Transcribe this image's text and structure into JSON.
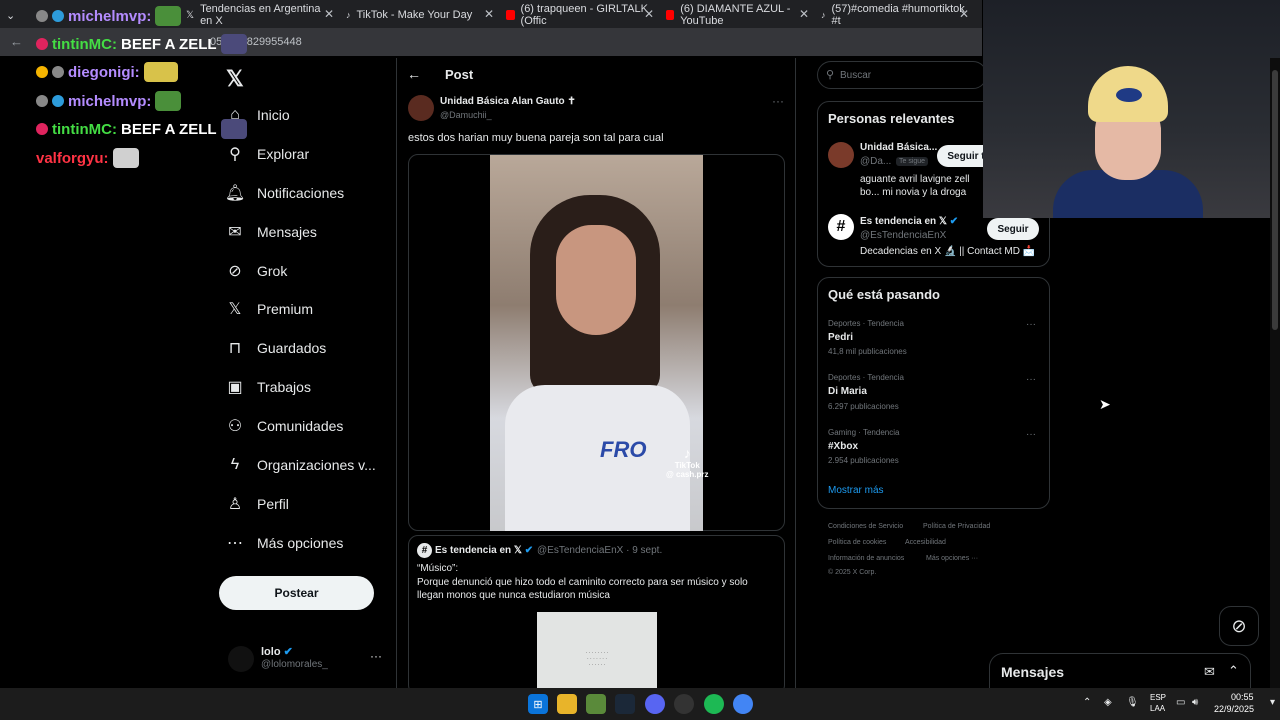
{
  "browser": {
    "tabs": [
      {
        "label": "",
        "color": "#e0245e"
      },
      {
        "label": "Tendencias en Argentina en X",
        "color": "#ffffff"
      },
      {
        "label": "TikTok - Make Your Day",
        "color": "#ffffff"
      },
      {
        "label": "(6) trapqueen - GIRLTALK (Offic",
        "color": "#ff0000"
      },
      {
        "label": "(6) DIAMANTE AZUL - YouTube",
        "color": "#ff0000"
      },
      {
        "label": "(57)#comedia #humortiktok #t",
        "color": "#ffffff"
      }
    ],
    "url_fragment": "056122829955448"
  },
  "chat": [
    {
      "user": "michelmvp:",
      "color": "#9b59ff",
      "msg": "",
      "badge": "#888888"
    },
    {
      "user": "tintinMC:",
      "color": "#44dd44",
      "msg": "BEEF A ZELL",
      "badge": "#e0245e"
    },
    {
      "user": "diegonigi:",
      "color": "#9b59ff",
      "msg": "",
      "badge": "#f5b400"
    },
    {
      "user": "michelmvp:",
      "color": "#9b59ff",
      "msg": "",
      "badge": "#888888"
    },
    {
      "user": "tintinMC:",
      "color": "#44dd44",
      "msg": "BEEF A ZELL",
      "badge": "#e0245e"
    },
    {
      "user": "valforgyu:",
      "color": "#ff3344",
      "msg": "",
      "badge": ""
    }
  ],
  "nav": {
    "logo": "X",
    "items": [
      "Inicio",
      "Explorar",
      "Notificaciones",
      "Mensajes",
      "Grok",
      "Premium",
      "Guardados",
      "Trabajos",
      "Comunidades",
      "Organizaciones v...",
      "Perfil",
      "Más opciones"
    ],
    "post_button": "Postear",
    "user_name": "lolo",
    "user_handle": "@lolomorales_",
    "more": "···"
  },
  "post": {
    "header": "Post",
    "author_name": "Unidad Básica Alan Gauto ✝",
    "author_handle": "@Damuchii_",
    "more": "···",
    "text": "estos dos harian muy buena pareja son tal para cual",
    "video_shirt": "FRO",
    "video_watermark": "TikTok\n@ cash.prz"
  },
  "quote": {
    "name": "Es tendencia en 𝕏",
    "handle": "@EsTendenciaEnX · 9 sept.",
    "line1": "“Músico”:",
    "line2": "Porque denunció que hizo todo el caminito correcto para ser músico y solo llegan monos que nunca estudiaron música"
  },
  "search": {
    "placeholder": "Buscar"
  },
  "people": {
    "title": "Personas relevantes",
    "list": [
      {
        "name": "Unidad Básica...",
        "handle": "@Da...",
        "tag": "Te sigue",
        "bio": "aguante avril lavigne zell bo... mi novia y la droga",
        "follow": "Seguir t",
        "avatar": "#7a3a2a"
      },
      {
        "name": "Es tendencia en 𝕏",
        "handle": "@EsTendenciaEnX",
        "bio": "Decadencias en X 🔬 || Contact MD 📩",
        "follow": "Seguir",
        "avatar": "#ffffff"
      }
    ]
  },
  "trends": {
    "title": "Qué está pasando",
    "items": [
      {
        "category": "Deportes · Tendencia",
        "name": "Pedri",
        "count": "41,8 mil publicaciones"
      },
      {
        "category": "Deportes · Tendencia",
        "name": "Di Maria",
        "count": "6.297 publicaciones"
      },
      {
        "category": "Gaming · Tendencia",
        "name": "#Xbox",
        "count": "2.954 publicaciones"
      }
    ],
    "show_more": "Mostrar más"
  },
  "footer": {
    "links": [
      "Condiciones de Servicio",
      "Política de Privacidad",
      "Política de cookies",
      "Accesibilidad",
      "Información de anuncios",
      "Más opciones ···",
      "© 2025 X Corp."
    ]
  },
  "messages_drawer": {
    "title": "Mensajes"
  },
  "taskbar": {
    "lang1": "ESP",
    "lang2": "LAA",
    "time": "00:55",
    "date": "22/9/2025"
  }
}
